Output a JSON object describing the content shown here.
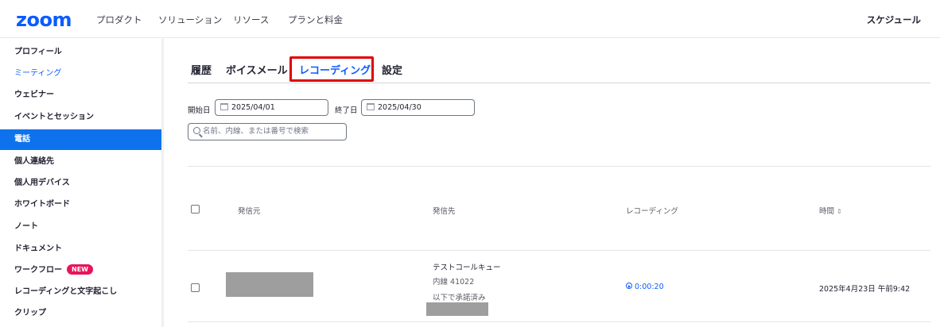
{
  "topnav": {
    "logo": "zoom",
    "items": [
      "プロダクト",
      "ソリューション",
      "リソース",
      "プランと料金"
    ],
    "schedule": "スケジュール"
  },
  "sidebar": {
    "items": [
      {
        "label": "プロフィール"
      },
      {
        "label": "ミーティング"
      },
      {
        "label": "ウェビナー"
      },
      {
        "label": "イベントとセッション"
      },
      {
        "label": "電話"
      },
      {
        "label": "個人連絡先"
      },
      {
        "label": "個人用デバイス"
      },
      {
        "label": "ホワイトボード"
      },
      {
        "label": "ノート"
      },
      {
        "label": "ドキュメント"
      },
      {
        "label": "ワークフロー",
        "badge": "NEW"
      },
      {
        "label": "レコーディングと文字起こし"
      },
      {
        "label": "クリップ"
      }
    ]
  },
  "tabs": [
    "履歴",
    "ボイスメール",
    "レコーディング",
    "設定"
  ],
  "filters": {
    "start_label": "開始日",
    "start_value": "2025/04/01",
    "end_label": "終了日",
    "end_value": "2025/04/30",
    "search_placeholder": "名前、内線、または番号で検索"
  },
  "table": {
    "columns": [
      "発信元",
      "発信先",
      "レコーディング",
      "時間"
    ],
    "rows": [
      {
        "to_name": "テストコールキュー",
        "to_ext": "内線 41022",
        "to_status": "以下で承諾済み",
        "recording": "0:00:20",
        "time": "2025年4月23日 午前9:42"
      }
    ]
  },
  "colors": {
    "brand": "#0b5cff",
    "active_nav": "#0e72ed",
    "highlight": "#e00000",
    "badge": "#e8145a",
    "redaction": "#9e9e9e"
  }
}
